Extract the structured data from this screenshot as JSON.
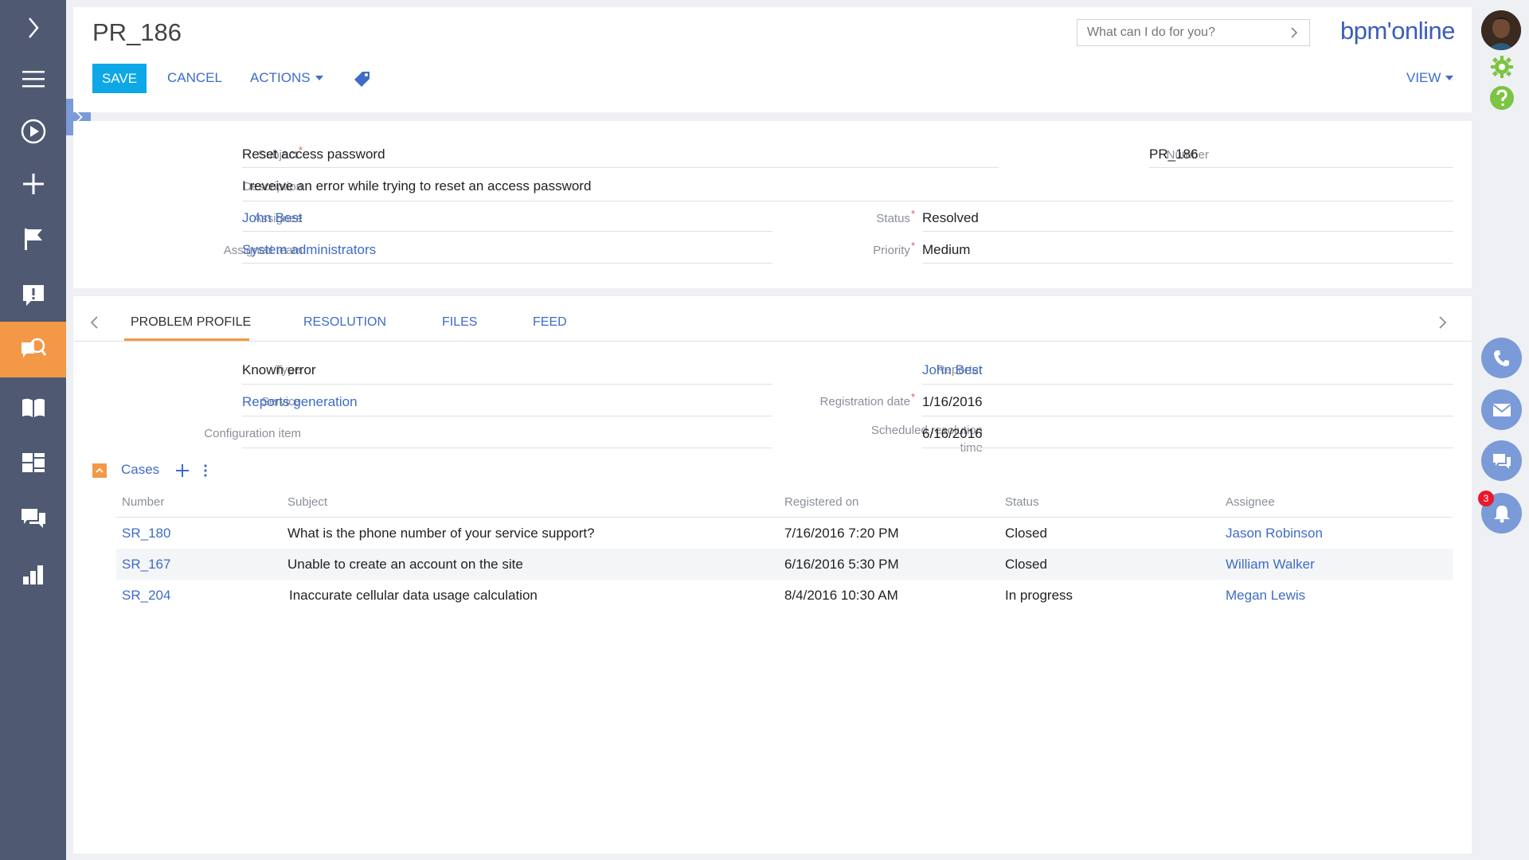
{
  "header": {
    "title": "PR_186",
    "save_label": "SAVE",
    "cancel_label": "CANCEL",
    "actions_label": "ACTIONS",
    "view_label": "VIEW",
    "search_placeholder": "What can I do for you?",
    "brand": "bpm'online"
  },
  "fields": {
    "subject": {
      "label": "Subject",
      "value": "Reset access password"
    },
    "number": {
      "label": "Number",
      "value": "PR_186"
    },
    "description": {
      "label": "Description",
      "value": "I reveive an error while trying to reset an access password"
    },
    "assignee": {
      "label": "Assignee",
      "value": "John Best"
    },
    "status": {
      "label": "Status",
      "value": "Resolved"
    },
    "assigned_team": {
      "label": "Assigned team",
      "value": "System administrators"
    },
    "priority": {
      "label": "Priority",
      "value": "Medium"
    }
  },
  "tabs": [
    {
      "label": "PROBLEM PROFILE"
    },
    {
      "label": "RESOLUTION"
    },
    {
      "label": "FILES"
    },
    {
      "label": "FEED"
    }
  ],
  "profile": {
    "type": {
      "label": "Type",
      "value": "Known error"
    },
    "service": {
      "label": "Service",
      "value": "Reports generation"
    },
    "config_item": {
      "label": "Configuration item",
      "value": ""
    },
    "reporter": {
      "label": "Reporter",
      "value": "John Best"
    },
    "registration_date": {
      "label": "Registration date",
      "value": "1/16/2016"
    },
    "scheduled_resolution": {
      "label_line1": "Scheduled resolution",
      "label_line2": "time",
      "value": "6/16/2016"
    }
  },
  "cases": {
    "title": "Cases",
    "columns": [
      "Number",
      "Subject",
      "Registered on",
      "Status",
      "Assignee"
    ],
    "rows": [
      {
        "number": "SR_180",
        "subject": "What is the phone number of your service support?",
        "registered": "7/16/2016 7:20 PM",
        "status": "Closed",
        "assignee": "Jason Robinson"
      },
      {
        "number": "SR_167",
        "subject": "Unable to create an account on the site",
        "registered": "6/16/2016 5:30 PM",
        "status": "Closed",
        "assignee": "William Walker"
      },
      {
        "number": "SR_204",
        "subject": "Inaccurate cellular data usage calculation",
        "registered": "8/4/2016 10:30 AM",
        "status": "In progress",
        "assignee": "Megan Lewis"
      }
    ]
  },
  "notifications": {
    "count": "3"
  },
  "colors": {
    "accent": "#0ea7e8",
    "sidebar": "#4f5a72",
    "active": "#f39847",
    "link": "#3e6cc7"
  }
}
